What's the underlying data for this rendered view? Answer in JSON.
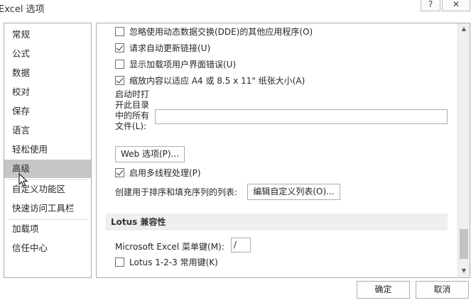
{
  "window": {
    "title": "Excel 选项",
    "help_label": "?",
    "close_label": "✕"
  },
  "sidebar": {
    "items": [
      {
        "label": "常规"
      },
      {
        "label": "公式"
      },
      {
        "label": "数据"
      },
      {
        "label": "校对"
      },
      {
        "label": "保存"
      },
      {
        "label": "语言"
      },
      {
        "label": "轻松使用"
      },
      {
        "label": "高级",
        "selected": true
      },
      {
        "label": "自定义功能区"
      },
      {
        "label": "快速访问工具栏"
      },
      {
        "label": "加载项"
      },
      {
        "label": "信任中心"
      }
    ]
  },
  "options": {
    "ignore_dde": {
      "label": "忽略使用动态数据交换(DDE)的其他应用程序(O)",
      "checked": false
    },
    "auto_update_links": {
      "label": "请求自动更新链接(U)",
      "checked": true
    },
    "show_addin_errors": {
      "label": "显示加载项用户界面错误(U)",
      "checked": false
    },
    "scale_content": {
      "label": "缩放内容以适应 A4 或 8.5 x 11\" 纸张大小(A)",
      "checked": true
    },
    "startup_label": "启动时打开此目录中的所有文件(L):",
    "startup_value": "",
    "web_options_label": "Web 选项(P)...",
    "multithread": {
      "label": "启用多线程处理(P)",
      "checked": true
    },
    "custom_list_label": "创建用于排序和填充序列的列表:",
    "edit_custom_lists_label": "编辑自定义列表(O)..."
  },
  "lotus": {
    "section_title": "Lotus 兼容性",
    "menu_key_label": "Microsoft Excel 菜单键(M):",
    "menu_key_value": "/",
    "navigation_keys": {
      "label": "Lotus 1-2-3 常用键(K)",
      "checked": false
    }
  },
  "footer": {
    "ok_label": "确定",
    "cancel_label": "取消"
  }
}
